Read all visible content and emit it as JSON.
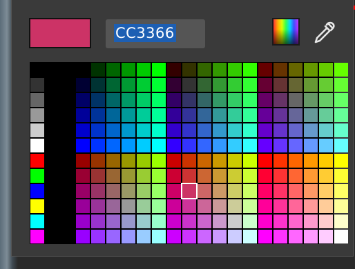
{
  "picker": {
    "current_color": "#CC3366",
    "hex_value": "CC3366",
    "selected_color": "#CC3366"
  },
  "buttons": {
    "spectrum_icon": "color-spectrum-icon",
    "eyedropper_icon": "eyedropper-icon"
  },
  "palette": {
    "left_column_colors": [
      "#000000",
      "#333333",
      "#666666",
      "#999999",
      "#CCCCCC",
      "#FFFFFF",
      "#FF0000",
      "#00FF00",
      "#0000FF",
      "#FFFF00",
      "#00FFFF",
      "#FF00FF"
    ],
    "component_levels": [
      "00",
      "33",
      "66",
      "99",
      "CC",
      "FF"
    ]
  },
  "colors": {
    "panel_bg": "#3a3a3a",
    "highlight": "#1d5fb3",
    "accent_red": "#ff0000"
  }
}
